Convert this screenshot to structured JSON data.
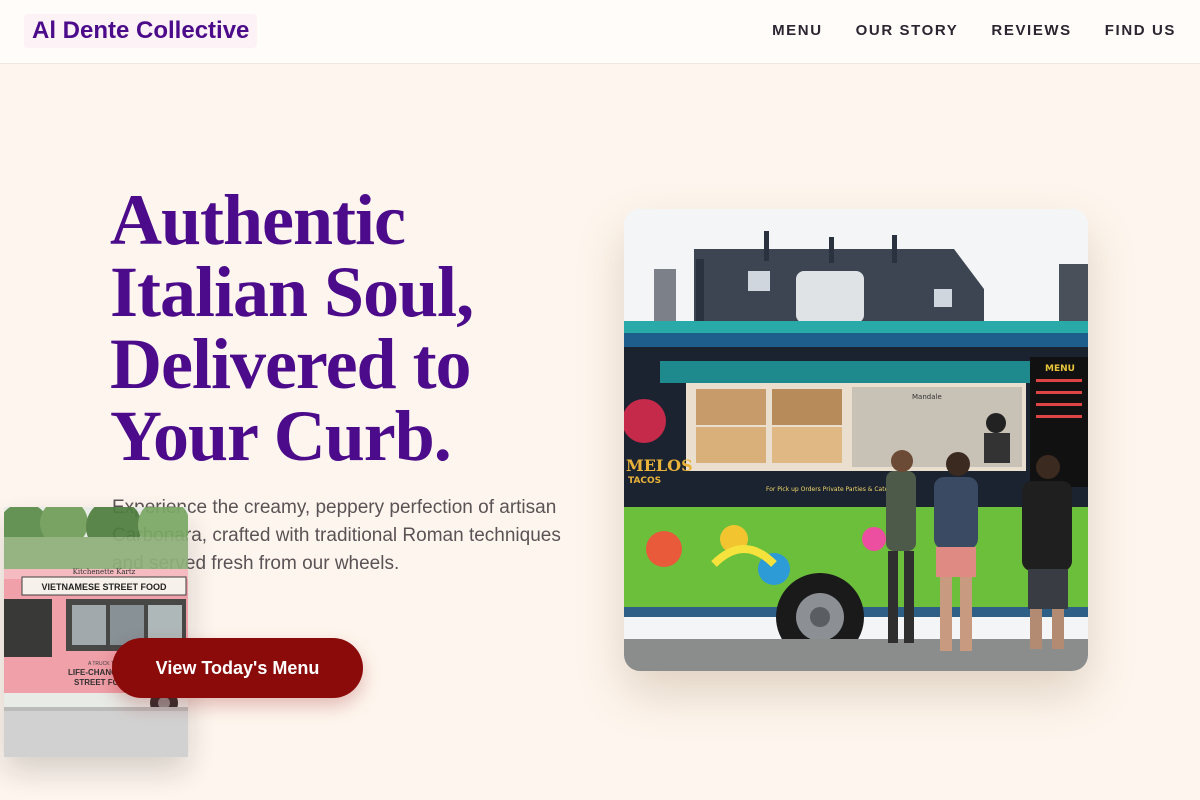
{
  "brand": {
    "name": "Al Dente Collective"
  },
  "nav": {
    "items": [
      {
        "label": "MENU"
      },
      {
        "label": "OUR STORY"
      },
      {
        "label": "REVIEWS"
      },
      {
        "label": "FIND US"
      }
    ]
  },
  "hero": {
    "headline_lines": [
      "Authentic",
      "Italian Soul,",
      "Delivered to",
      "Your Curb."
    ],
    "subtext": "Experience the creamy, peppery perfection of artisan Carbonara, crafted with traditional Roman techniques and served fresh from our wheels.",
    "cta_label": "View Today's Menu"
  },
  "side_photo": {
    "sign_top": "Kitchenette Kartz",
    "sign": "VIETNAMESE STREET FOOD",
    "slogan_line1": "LIFE-CHANGING",
    "slogan_line2": "STREET FOOD",
    "tagline": "A TRUCK THAT'S"
  },
  "main_photo": {
    "truck_side_text": "For Pick up Orders Private Parties & Catering Plus",
    "truck_logo": "MELOS",
    "truck_logo_sub": "TACOS",
    "window_sign": "Mandale",
    "menu_board_header": "MENU"
  },
  "colors": {
    "brand": "#4b0b8a",
    "cta": "#8b0a0a",
    "background": "#fef6ee"
  }
}
